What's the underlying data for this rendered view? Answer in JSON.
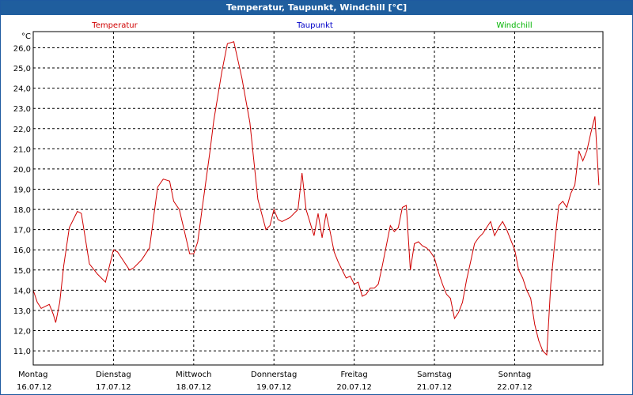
{
  "window": {
    "title": "Temperatur, Taupunkt, Windchill [°C]"
  },
  "colors": {
    "title_bar": "#1f5e9e",
    "temperatur": "#d00000",
    "taupunkt": "#0000c8",
    "windchill": "#00b400"
  },
  "chart_data": {
    "type": "line",
    "title": "Temperatur, Taupunkt, Windchill [°C]",
    "ylabel": "°C",
    "ylim": [
      10.3,
      26.8
    ],
    "yticks": [
      "11,0",
      "12,0",
      "13,0",
      "14,0",
      "15,0",
      "16,0",
      "17,0",
      "18,0",
      "19,0",
      "20,0",
      "21,0",
      "22,0",
      "23,0",
      "24,0",
      "25,0",
      "26,0"
    ],
    "xlim": [
      0,
      7.1
    ],
    "xticks": [
      {
        "day": "Montag",
        "date": "16.07.12",
        "x": 0
      },
      {
        "day": "Dienstag",
        "date": "17.07.12",
        "x": 1
      },
      {
        "day": "Mittwoch",
        "date": "18.07.12",
        "x": 2
      },
      {
        "day": "Donnerstag",
        "date": "19.07.12",
        "x": 3
      },
      {
        "day": "Freitag",
        "date": "20.07.12",
        "x": 4
      },
      {
        "day": "Samstag",
        "date": "21.07.12",
        "x": 5
      },
      {
        "day": "Sonntag",
        "date": "22.07.12",
        "x": 6
      }
    ],
    "grid": true,
    "legend": [
      "Temperatur",
      "Taupunkt",
      "Windchill"
    ],
    "series": [
      {
        "name": "Temperatur",
        "x": [
          0,
          0.05,
          0.1,
          0.15,
          0.2,
          0.25,
          0.28,
          0.33,
          0.38,
          0.45,
          0.55,
          0.6,
          0.7,
          0.8,
          0.9,
          1.0,
          1.05,
          1.1,
          1.2,
          1.25,
          1.35,
          1.45,
          1.55,
          1.62,
          1.7,
          1.75,
          1.82,
          1.88,
          1.95,
          2.0,
          2.05,
          2.1,
          2.2,
          2.25,
          2.35,
          2.42,
          2.5,
          2.6,
          2.7,
          2.8,
          2.9,
          2.95,
          3.0,
          3.05,
          3.1,
          3.2,
          3.3,
          3.35,
          3.4,
          3.5,
          3.55,
          3.6,
          3.65,
          3.7,
          3.75,
          3.8,
          3.85,
          3.9,
          3.95,
          4.0,
          4.05,
          4.1,
          4.15,
          4.2,
          4.25,
          4.3,
          4.35,
          4.45,
          4.5,
          4.55,
          4.6,
          4.65,
          4.7,
          4.75,
          4.8,
          4.85,
          4.9,
          4.95,
          5.0,
          5.05,
          5.1,
          5.15,
          5.2,
          5.25,
          5.3,
          5.35,
          5.4,
          5.45,
          5.5,
          5.55,
          5.6,
          5.65,
          5.7,
          5.75,
          5.8,
          5.85,
          5.9,
          5.95,
          6.0,
          6.05,
          6.1,
          6.15,
          6.2,
          6.25,
          6.3,
          6.35,
          6.4,
          6.45,
          6.5,
          6.55,
          6.6,
          6.65,
          6.7,
          6.75,
          6.8,
          6.85,
          6.9,
          6.95,
          7.0,
          7.05
        ],
        "values": [
          14.0,
          13.4,
          13.1,
          13.2,
          13.3,
          12.8,
          12.4,
          13.4,
          15.2,
          17.1,
          17.9,
          17.8,
          15.3,
          14.8,
          14.4,
          16.0,
          15.9,
          15.6,
          15.0,
          15.1,
          15.5,
          16.1,
          19.1,
          19.5,
          19.4,
          18.4,
          18.0,
          17.0,
          15.8,
          15.8,
          16.4,
          17.9,
          20.8,
          22.4,
          24.8,
          26.2,
          26.3,
          24.5,
          22.3,
          18.5,
          17.0,
          17.2,
          18.0,
          17.5,
          17.4,
          17.6,
          18.0,
          19.8,
          18.0,
          16.7,
          17.8,
          16.6,
          17.8,
          16.9,
          15.9,
          15.4,
          15.0,
          14.6,
          14.7,
          14.3,
          14.4,
          13.7,
          13.8,
          14.1,
          14.1,
          14.3,
          15.2,
          17.2,
          16.9,
          17.1,
          18.1,
          18.2,
          15.0,
          16.3,
          16.4,
          16.2,
          16.1,
          15.9,
          15.6,
          14.9,
          14.3,
          13.8,
          13.6,
          12.6,
          12.9,
          13.4,
          14.5,
          15.4,
          16.3,
          16.6,
          16.8,
          17.1,
          17.4,
          16.7,
          17.1,
          17.4,
          17.0,
          16.5,
          16.0,
          15.0,
          14.6,
          14.0,
          13.6,
          12.3,
          11.5,
          11.0,
          10.8,
          14.3,
          16.4,
          18.2,
          18.4,
          18.1,
          18.8,
          19.2,
          20.9,
          20.4,
          20.9,
          21.8,
          22.6,
          19.2
        ]
      }
    ]
  }
}
